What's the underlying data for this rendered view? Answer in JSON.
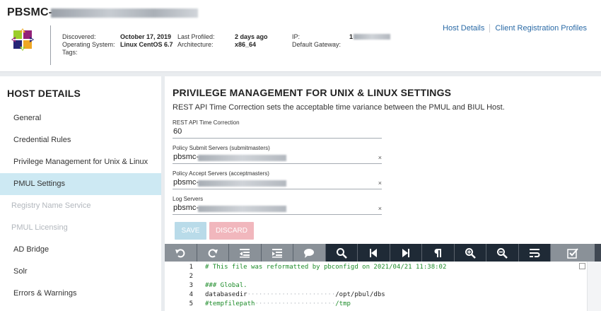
{
  "header": {
    "host_title": "PBSMC-",
    "discovered_label": "Discovered:",
    "discovered_value": "October 17, 2019",
    "os_label": "Operating System:",
    "os_value": "Linux CentOS 6.7",
    "tags_label": "Tags:",
    "last_profiled_label": "Last Profiled:",
    "last_profiled_value": "2 days ago",
    "architecture_label": "Architecture:",
    "architecture_value": "x86_64",
    "ip_label": "IP:",
    "ip_value": "1",
    "gateway_label": "Default Gateway:",
    "links": [
      "Host Details",
      "Client Registration Profiles"
    ]
  },
  "sidebar": {
    "title": "HOST DETAILS",
    "items": [
      {
        "label": "General",
        "state": "normal"
      },
      {
        "label": "Credential Rules",
        "state": "normal"
      },
      {
        "label": "Privilege Management for Unix & Linux",
        "state": "normal"
      },
      {
        "label": "PMUL Settings",
        "state": "active"
      },
      {
        "label": "Registry Name Service",
        "state": "disabled"
      },
      {
        "label": "PMUL Licensing",
        "state": "disabled"
      },
      {
        "label": "AD Bridge",
        "state": "normal"
      },
      {
        "label": "Solr",
        "state": "normal"
      },
      {
        "label": "Errors & Warnings",
        "state": "normal"
      }
    ]
  },
  "main": {
    "title": "PRIVILEGE MANAGEMENT FOR UNIX & LINUX SETTINGS",
    "description": "REST API Time Correction sets the acceptable time variance between the PMUL and BIUL Host.",
    "fields": [
      {
        "label": "REST API Time Correction",
        "value": "60"
      },
      {
        "label": "Policy Submit Servers (submitmasters)",
        "value": "pbsmc-"
      },
      {
        "label": "Policy Accept Servers (acceptmasters)",
        "value": "pbsmc-"
      },
      {
        "label": "Log Servers",
        "value": "pbsmc-"
      }
    ],
    "clear_glyph": "×",
    "save_label": "SAVE",
    "discard_label": "DISCARD"
  },
  "toolbar": {
    "buttons": [
      "undo-icon",
      "redo-icon",
      "outdent-icon",
      "indent-icon",
      "comment-icon",
      "search-icon",
      "first-icon",
      "last-icon",
      "pilcrow-icon",
      "zoom-in-icon",
      "zoom-out-icon",
      "wrap-icon",
      "check-icon"
    ]
  },
  "editor": {
    "lines": [
      {
        "num": "1",
        "text": "# This file was reformatted by pbconfigd on 2021/04/21 11:38:02"
      },
      {
        "num": "2",
        "text": ""
      },
      {
        "num": "3",
        "text": "### Global."
      },
      {
        "num": "4",
        "key": "databasedir",
        "dots": "·······················",
        "val": "/opt/pbul/dbs"
      },
      {
        "num": "5",
        "key": "#tempfilepath",
        "dots": "·····················",
        "val": "/tmp"
      }
    ]
  }
}
